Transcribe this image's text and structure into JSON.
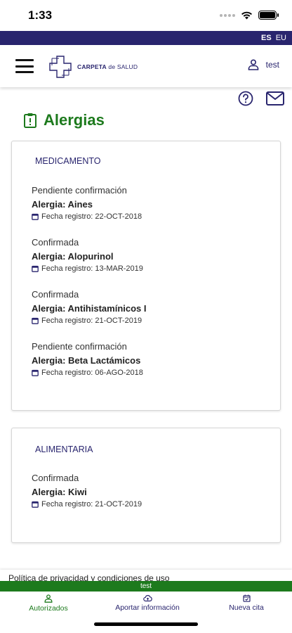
{
  "status_bar": {
    "time": "1:33"
  },
  "language_bar": {
    "options": [
      "ES",
      "EU"
    ],
    "active": "ES"
  },
  "header": {
    "logo_primary": "CARPETA",
    "logo_secondary": "de SALUD",
    "user_name": "test"
  },
  "page": {
    "title": "Alergias"
  },
  "sections": [
    {
      "heading": "MEDICAMENTO",
      "items": [
        {
          "status": "Pendiente confirmación",
          "name": "Alergia: Aines",
          "date": "Fecha registro: 22-OCT-2018"
        },
        {
          "status": "Confirmada",
          "name": "Alergia: Alopurinol",
          "date": "Fecha registro: 13-MAR-2019"
        },
        {
          "status": "Confirmada",
          "name": "Alergia: Antihistamínicos I",
          "date": "Fecha registro: 21-OCT-2019"
        },
        {
          "status": "Pendiente confirmación",
          "name": "Alergia: Beta Lactámicos",
          "date": "Fecha registro: 06-AGO-2018"
        }
      ]
    },
    {
      "heading": "ALIMENTARIA",
      "items": [
        {
          "status": "Confirmada",
          "name": "Alergia: Kiwi",
          "date": "Fecha registro: 21-OCT-2019"
        }
      ]
    }
  ],
  "footer": {
    "privacy_link": "Política de privacidad y condiciones de uso",
    "environment": "test"
  },
  "tabs": [
    {
      "label": "Autorizados",
      "icon": "person-icon"
    },
    {
      "label": "Aportar información",
      "icon": "cloud-upload-icon"
    },
    {
      "label": "Nueva cita",
      "icon": "calendar-check-icon"
    }
  ],
  "colors": {
    "brand_navy": "#29256e",
    "brand_green": "#1d7a1d"
  }
}
